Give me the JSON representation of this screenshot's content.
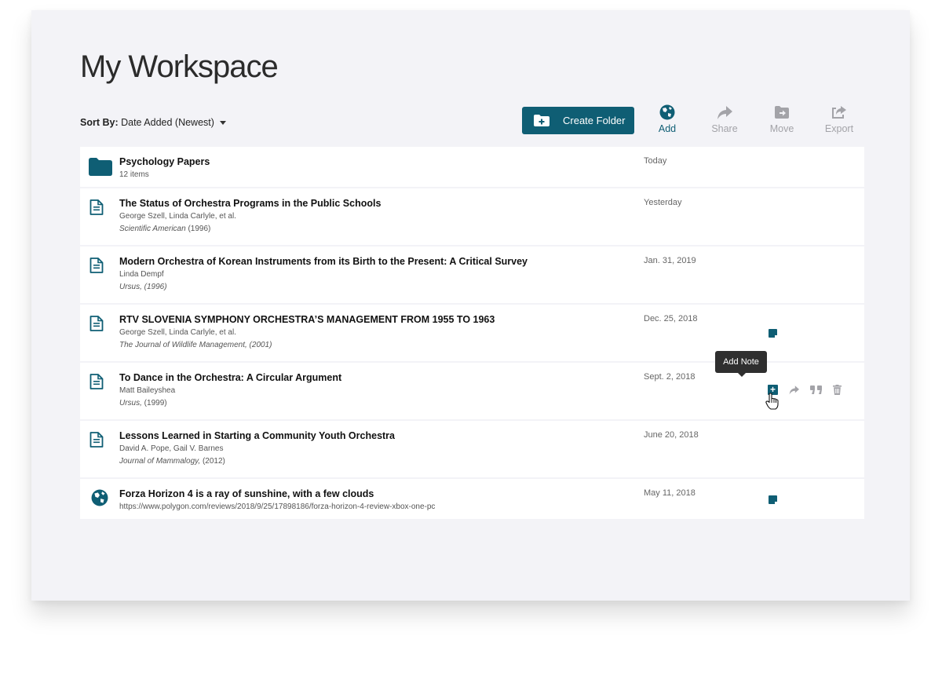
{
  "workspace": {
    "title": "My Workspace"
  },
  "sort": {
    "label": "Sort By:",
    "value": "Date Added (Newest)"
  },
  "toolbar": {
    "create_folder": "Create Folder",
    "add": "Add",
    "share": "Share",
    "move": "Move",
    "export": "Export"
  },
  "colors": {
    "accent": "#0f5e74",
    "muted": "#a3a3a8",
    "panel_bg": "#f3f3f7"
  },
  "items": [
    {
      "type": "folder",
      "icon": "folder-icon",
      "title": "Psychology Papers",
      "count": "12 items",
      "date": "Today"
    },
    {
      "type": "document",
      "icon": "document-icon",
      "title": "The Status of Orchestra Programs in the Public Schools",
      "authors": "George Szell, Linda Carlyle, et al.",
      "journal": "Scientific American",
      "year": " (1996)",
      "date": "Yesterday"
    },
    {
      "type": "document",
      "icon": "document-icon",
      "title": "Modern Orchestra of Korean Instruments from its Birth to the Present: A Critical Survey",
      "authors": "Linda Dempf",
      "journal": "Ursus, (1996)",
      "date": "Jan. 31, 2019"
    },
    {
      "type": "document",
      "icon": "document-icon",
      "title": "RTV SLOVENIA SYMPHONY ORCHESTRA’S MANAGEMENT FROM 1955 TO 1963",
      "authors": "George Szell, Linda Carlyle, et al.",
      "journal": "The Journal of Wildlife Management, (2001)",
      "date": "Dec. 25, 2018",
      "has_note": true
    },
    {
      "type": "document",
      "icon": "document-icon",
      "title": "To Dance in the Orchestra: A Circular Argument",
      "authors": "Matt Baileyshea",
      "journal": "Ursus,",
      "year": " (1999)",
      "date": "Sept. 2, 2018",
      "hovered": true
    },
    {
      "type": "document",
      "icon": "document-icon",
      "title": "Lessons Learned in Starting a Community Youth Orchestra",
      "authors": "David A. Pope, Gail V. Barnes",
      "journal": "Journal of Mammalogy,",
      "year": " (2012)",
      "date": "June 20, 2018"
    },
    {
      "type": "web",
      "icon": "globe-icon",
      "title": "Forza Horizon 4 is a ray of sunshine, with a few clouds",
      "url": "https://www.polygon.com/reviews/2018/9/25/17898186/forza-horizon-4-review-xbox-one-pc",
      "date": "May 11, 2018",
      "has_note": true
    }
  ],
  "row_actions": [
    "add-note-icon",
    "share-icon",
    "quote-icon",
    "trash-icon"
  ],
  "tooltip": {
    "text": "Add Note"
  }
}
